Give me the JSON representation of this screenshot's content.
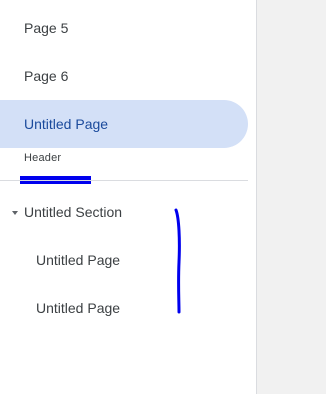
{
  "sidebar": {
    "items": [
      {
        "label": "Page 5"
      },
      {
        "label": "Page 6"
      },
      {
        "label": "Untitled Page",
        "selected": true
      }
    ],
    "header_label": "Header",
    "section": {
      "label": "Untitled Section",
      "expanded": true,
      "pages": [
        {
          "label": "Untitled Page"
        },
        {
          "label": "Untitled Page"
        }
      ]
    }
  },
  "colors": {
    "selected_bg": "#d3e0f7",
    "selected_text": "#1a4a9c",
    "annotation_blue": "#0000ee"
  },
  "icons": {
    "section_toggle": "caret-down-icon"
  }
}
